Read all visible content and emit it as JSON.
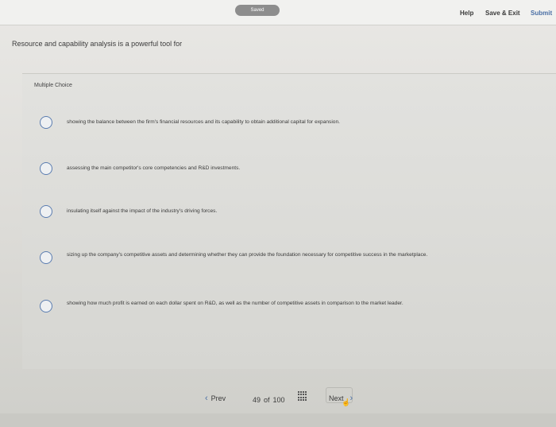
{
  "header": {
    "saved_label": "Saved",
    "help_label": "Help",
    "save_exit_label": "Save & Exit",
    "submit_label": "Submit"
  },
  "question": {
    "prompt": "Resource and capability analysis is a powerful tool for",
    "type_label": "Multiple Choice",
    "options": [
      "showing the balance between the firm's financial resources and its capability to obtain additional capital for expansion.",
      "assessing the main competitor's core competencies and R&D investments.",
      "insulating itself against the impact of the industry's driving forces.",
      "sizing up the company's competitive assets and determining whether they can provide the foundation necessary for competitive success in the marketplace.",
      "showing how much profit is earned on each dollar spent on R&D, as well as the number of competitive assets in comparison to the market leader."
    ]
  },
  "footer": {
    "prev_label": "Prev",
    "current": "49",
    "of_label": "of",
    "total": "100",
    "next_label": "Next"
  },
  "colors": {
    "accent": "#4a6fa5",
    "radio_border": "#5b7db0"
  },
  "icons": {
    "prev": "chevron-left-icon",
    "next": "chevron-right-icon",
    "grid": "question-grid-icon",
    "cursor": "hand-cursor-icon"
  }
}
